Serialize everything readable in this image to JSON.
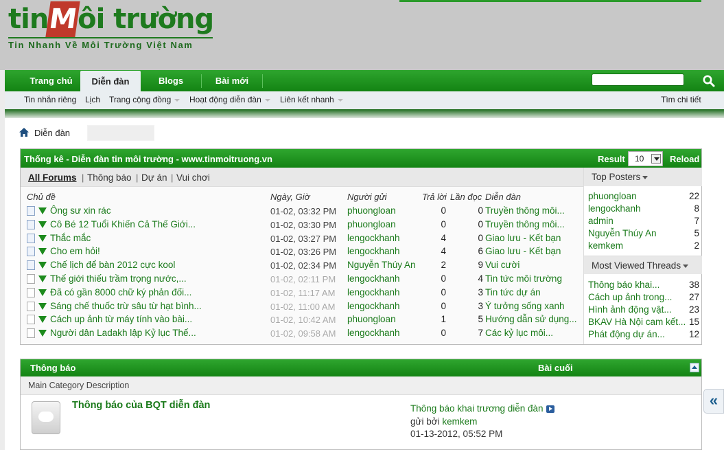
{
  "header": {
    "logo_left": "tin",
    "logo_mark": "M",
    "logo_right": "ôi trường",
    "logo_tagline": "Tin Nhanh Về Môi Trường Việt Nam"
  },
  "nav": {
    "tabs": [
      "Trang chủ",
      "Diễn đàn",
      "Blogs",
      "Bài mới"
    ],
    "active_tab": "Diễn đàn",
    "search_placeholder": ""
  },
  "subnav": {
    "items": [
      {
        "label": "Tin nhắn riêng",
        "dropdown": false
      },
      {
        "label": "Lịch",
        "dropdown": false
      },
      {
        "label": "Trang cộng đồng",
        "dropdown": true
      },
      {
        "label": "Hoạt động diễn đàn",
        "dropdown": true
      },
      {
        "label": "Liên kết nhanh",
        "dropdown": true
      }
    ],
    "advanced_search": "Tìm chi tiết"
  },
  "breadcrumb": {
    "label": "Diễn đàn"
  },
  "stats": {
    "title": "Thống kê - Diễn đàn tin môi trường - www.tinmoitruong.vn",
    "result_label": "Result",
    "result_value": "10",
    "reload_label": "Reload",
    "tabs": [
      "All Forums",
      "Thông báo",
      "Dự án",
      "Vui chơi"
    ],
    "columns": {
      "subject": "Chủ đề",
      "datetime": "Ngày, Giờ",
      "poster": "Người gửi",
      "replies": "Trả lời",
      "views": "Lần đọc",
      "forum": "Diễn đàn"
    },
    "threads": [
      {
        "title": "Ông sư xin rác",
        "time": "01-02, 03:32 PM",
        "user": "phuongloan",
        "replies": "0",
        "views": "0",
        "forum": "Truyền thông môi...",
        "new": true
      },
      {
        "title": "Cô Bé 12 Tuổi Khiến Cả Thế Giới...",
        "time": "01-02, 03:30 PM",
        "user": "phuongloan",
        "replies": "0",
        "views": "0",
        "forum": "Truyền thông môi...",
        "new": true
      },
      {
        "title": "Thắc mắc",
        "time": "01-02, 03:27 PM",
        "user": "lengockhanh",
        "replies": "4",
        "views": "0",
        "forum": "Giao lưu - Kết bạn",
        "new": true
      },
      {
        "title": "Cho em hỏi!",
        "time": "01-02, 03:26 PM",
        "user": "lengockhanh",
        "replies": "4",
        "views": "6",
        "forum": "Giao lưu - Kết bạn",
        "new": true
      },
      {
        "title": "Chế lịch để bàn 2012 cực kool",
        "time": "01-02, 02:34 PM",
        "user": "Nguyễn Thúy An",
        "replies": "2",
        "views": "9",
        "forum": "Vui cười",
        "new": true
      },
      {
        "title": "Thế giới thiếu trầm trọng nước,...",
        "time": "01-02, 02:11 PM",
        "user": "lengockhanh",
        "replies": "0",
        "views": "4",
        "forum": "Tin tức môi trường",
        "new": false
      },
      {
        "title": "Đã có gần 8000 chữ ký phản đối...",
        "time": "01-02, 11:17 AM",
        "user": "lengockhanh",
        "replies": "0",
        "views": "3",
        "forum": "Tin tức dự án",
        "new": false
      },
      {
        "title": "Sáng chế thuốc trừ sâu từ hạt bình...",
        "time": "01-02, 11:00 AM",
        "user": "lengockhanh",
        "replies": "0",
        "views": "3",
        "forum": "Ý tưởng sống xanh",
        "new": false
      },
      {
        "title": "Cách up ảnh từ máy tính vào bài...",
        "time": "01-02, 10:42 AM",
        "user": "phuongloan",
        "replies": "1",
        "views": "5",
        "forum": "Hướng dẫn sử dụng...",
        "new": false
      },
      {
        "title": "Người dân Ladakh lập Kỷ lục Thế...",
        "time": "01-02, 09:58 AM",
        "user": "lengockhanh",
        "replies": "0",
        "views": "7",
        "forum": "Các kỷ lục môi...",
        "new": false
      }
    ],
    "top_posters_label": "Top Posters",
    "top_posters": [
      {
        "name": "phuongloan",
        "count": "22"
      },
      {
        "name": "lengockhanh",
        "count": "8"
      },
      {
        "name": "admin",
        "count": "7"
      },
      {
        "name": "Nguyễn Thúy An",
        "count": "5"
      },
      {
        "name": "kemkem",
        "count": "2"
      }
    ],
    "most_viewed_label": "Most Viewed Threads",
    "most_viewed": [
      {
        "name": "Thông báo khai...",
        "count": "38"
      },
      {
        "name": "Cách up ảnh trong...",
        "count": "27"
      },
      {
        "name": "Hình ảnh động vật...",
        "count": "23"
      },
      {
        "name": "BKAV Hà Nội cam kết...",
        "count": "15"
      },
      {
        "name": "Phát động dự án...",
        "count": "12"
      }
    ]
  },
  "announcements": {
    "title": "Thông báo",
    "last_post_label": "Bài cuối",
    "category_desc": "Main Category Description",
    "forum_name": "Thông báo của BQT diễn đàn",
    "last_post_title": "Thông báo khai trương diễn đàn",
    "last_post_by_prefix": "gửi bởi",
    "last_post_user": "kemkem",
    "last_post_date": "01-13-2012, 05:52 PM"
  },
  "side_toggle": "«",
  "colors": {
    "brand_green": "#1a8a1a",
    "link_green": "#1a7a1a"
  }
}
